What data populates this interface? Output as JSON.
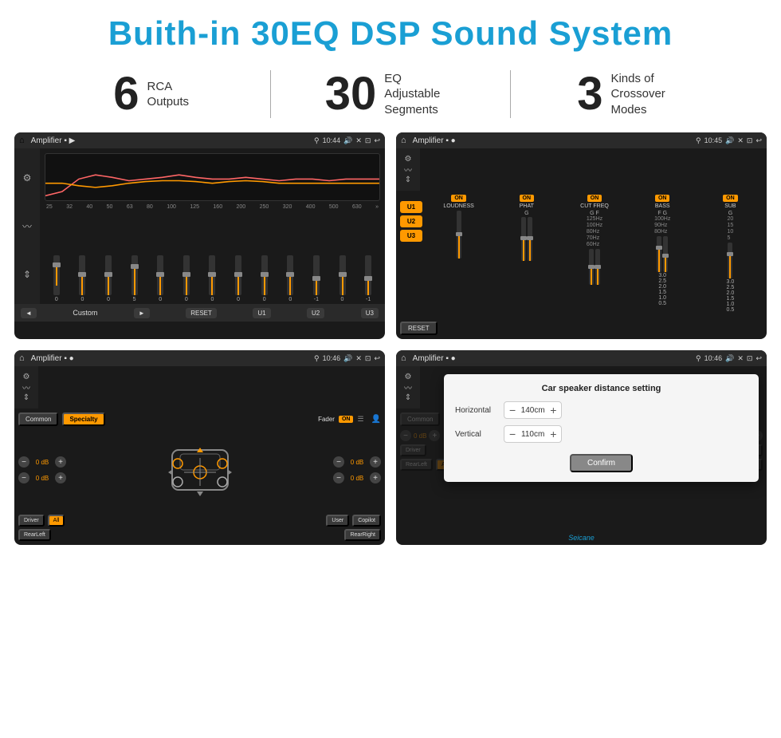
{
  "header": {
    "title": "Buith-in 30EQ DSP Sound System"
  },
  "stats": [
    {
      "number": "6",
      "label": "RCA\nOutputs"
    },
    {
      "number": "30",
      "label": "EQ Adjustable\nSegments"
    },
    {
      "number": "3",
      "label": "Kinds of\nCrossover Modes"
    }
  ],
  "screens": {
    "eq": {
      "title": "Amplifier",
      "time": "10:44",
      "freq_labels": [
        "25",
        "32",
        "40",
        "50",
        "63",
        "80",
        "100",
        "125",
        "160",
        "200",
        "250",
        "320",
        "400",
        "500",
        "630"
      ],
      "slider_values": [
        "0",
        "0",
        "0",
        "5",
        "0",
        "0",
        "0",
        "0",
        "0",
        "0",
        "-1",
        "0",
        "-1"
      ],
      "bottom": {
        "prev": "◄",
        "label": "Custom",
        "next": "►",
        "reset": "RESET",
        "u1": "U1",
        "u2": "U2",
        "u3": "U3"
      }
    },
    "amplifier": {
      "title": "Amplifier",
      "time": "10:45",
      "u_buttons": [
        "U1",
        "U2",
        "U3"
      ],
      "channels": [
        {
          "on": true,
          "name": "LOUDNESS"
        },
        {
          "on": true,
          "name": "PHAT"
        },
        {
          "on": true,
          "name": "CUT FREQ"
        },
        {
          "on": true,
          "name": "BASS"
        },
        {
          "on": true,
          "name": "SUB"
        }
      ],
      "reset_label": "RESET"
    },
    "fader": {
      "title": "Amplifier",
      "time": "10:46",
      "tabs": [
        "Common",
        "Specialty"
      ],
      "fader_label": "Fader",
      "on_label": "ON",
      "db_values": [
        "0 dB",
        "0 dB",
        "0 dB",
        "0 dB"
      ],
      "zone_buttons": [
        "Driver",
        "RearLeft",
        "All",
        "User",
        "RearRight",
        "Copilot"
      ]
    },
    "distance": {
      "title": "Amplifier",
      "time": "10:46",
      "overlay_title": "Car speaker distance setting",
      "horizontal_label": "Horizontal",
      "horizontal_value": "140cm",
      "vertical_label": "Vertical",
      "vertical_value": "110cm",
      "confirm_label": "Confirm",
      "db_values": [
        "0 dB",
        "0 dB"
      ],
      "zone_buttons": [
        "Driver",
        "RearLeft",
        "User",
        "RearRight",
        "Copilot"
      ]
    }
  },
  "watermark": "Seicane"
}
